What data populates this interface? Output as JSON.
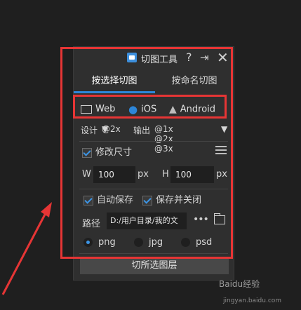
{
  "title": "切图工具",
  "tabs": [
    {
      "label": "按选择切图",
      "active": true
    },
    {
      "label": "按命名切图",
      "active": false
    }
  ],
  "platforms": [
    {
      "label": "Web"
    },
    {
      "label": "iOS"
    },
    {
      "label": "Android"
    }
  ],
  "design": {
    "label": "设计",
    "value": "@2x"
  },
  "output": {
    "label": "输出",
    "value": "@1x @2x @3x"
  },
  "resize": {
    "label": "修改尺寸",
    "checked": true
  },
  "width": {
    "label": "W",
    "value": "100",
    "unit": "px"
  },
  "height": {
    "label": "H",
    "value": "100",
    "unit": "px"
  },
  "autosave": {
    "label": "自动保存",
    "checked": true
  },
  "save_close": {
    "label": "保存并关闭",
    "checked": true
  },
  "path": {
    "label": "路径",
    "value": "D:/用户目录/我的文"
  },
  "formats": [
    {
      "label": "png",
      "selected": true
    },
    {
      "label": "jpg",
      "selected": false
    },
    {
      "label": "psd",
      "selected": false
    }
  ],
  "export_button": "切所选图层",
  "watermark": {
    "brand": "Baidu经验",
    "url": "jingyan.baidu.com"
  },
  "colors": {
    "accent": "#2d86d9",
    "highlight": "#e63535",
    "panel": "#2f2f2f"
  },
  "icons": [
    "app-icon",
    "help-icon",
    "pin-icon",
    "close-icon",
    "web-icon",
    "apple-icon",
    "android-icon",
    "sliders-icon",
    "more-icon",
    "folder-icon"
  ]
}
